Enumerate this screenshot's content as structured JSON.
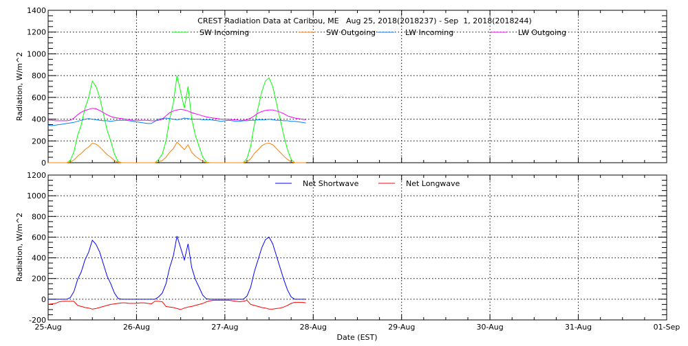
{
  "chart_data": [
    {
      "type": "line",
      "title": "CREST Radiation Data at Caribou, ME   Aug 25, 2018(2018237) - Sep  1, 2018(2018244)",
      "xlabel": "",
      "ylabel": "Radiation, W/m^2",
      "ylim": [
        0,
        1400
      ],
      "yticks": [
        "0",
        "200",
        "400",
        "600",
        "800",
        "1000",
        "1200",
        "1400"
      ],
      "grid": true,
      "legend": "top",
      "x_start_day": 0,
      "x_step_hours": 1,
      "series": [
        {
          "name": "SW Incoming",
          "color": "#00ff00",
          "values": [
            0,
            0,
            0,
            0,
            0,
            0,
            20,
            100,
            250,
            350,
            500,
            600,
            750,
            700,
            600,
            450,
            300,
            200,
            80,
            10,
            0,
            0,
            0,
            0,
            0,
            0,
            0,
            0,
            0,
            0,
            30,
            80,
            200,
            400,
            550,
            800,
            650,
            500,
            700,
            400,
            250,
            150,
            50,
            5,
            0,
            0,
            0,
            0,
            0,
            0,
            0,
            0,
            0,
            0,
            40,
            150,
            350,
            500,
            650,
            750,
            780,
            700,
            550,
            400,
            250,
            120,
            30,
            0,
            0,
            0,
            0
          ]
        },
        {
          "name": "SW Outgoing",
          "color": "#ff7f00",
          "values": [
            0,
            0,
            0,
            0,
            0,
            0,
            5,
            25,
            60,
            85,
            120,
            145,
            180,
            170,
            145,
            110,
            75,
            50,
            20,
            3,
            0,
            0,
            0,
            0,
            0,
            0,
            0,
            0,
            0,
            0,
            8,
            20,
            50,
            95,
            130,
            190,
            155,
            120,
            165,
            95,
            60,
            35,
            12,
            1,
            0,
            0,
            0,
            0,
            0,
            0,
            0,
            0,
            0,
            0,
            10,
            35,
            85,
            120,
            155,
            175,
            180,
            165,
            130,
            95,
            60,
            30,
            8,
            0,
            0,
            0,
            0
          ]
        },
        {
          "name": "LW Incoming",
          "color": "#0080ff",
          "values": [
            345,
            340,
            345,
            350,
            355,
            360,
            365,
            370,
            380,
            390,
            400,
            405,
            400,
            395,
            390,
            385,
            385,
            380,
            385,
            390,
            390,
            390,
            385,
            380,
            375,
            370,
            365,
            360,
            360,
            380,
            400,
            405,
            410,
            405,
            400,
            395,
            400,
            410,
            405,
            400,
            400,
            400,
            395,
            395,
            395,
            390,
            385,
            380,
            385,
            390,
            385,
            380,
            380,
            385,
            385,
            390,
            390,
            395,
            395,
            395,
            400,
            395,
            390,
            390,
            385,
            385,
            380,
            380,
            375,
            370,
            365
          ]
        },
        {
          "name": "LW Outgoing",
          "color": "#ff00ff",
          "values": [
            390,
            390,
            385,
            385,
            385,
            385,
            390,
            410,
            440,
            465,
            480,
            490,
            500,
            495,
            480,
            460,
            440,
            425,
            415,
            410,
            405,
            400,
            395,
            390,
            390,
            390,
            390,
            390,
            385,
            385,
            390,
            400,
            430,
            460,
            475,
            485,
            490,
            485,
            475,
            460,
            450,
            440,
            430,
            420,
            415,
            410,
            405,
            400,
            400,
            400,
            395,
            395,
            390,
            390,
            395,
            410,
            430,
            455,
            470,
            480,
            485,
            485,
            475,
            465,
            450,
            430,
            420,
            410,
            405,
            400,
            395
          ]
        }
      ]
    },
    {
      "type": "line",
      "xlabel": "Date (EST)",
      "ylabel": "Radiation, W/m^2",
      "ylim": [
        -200,
        1200
      ],
      "yticks": [
        "-200",
        "0",
        "200",
        "400",
        "600",
        "800",
        "1000",
        "1200"
      ],
      "xticks": [
        "25-Aug",
        "26-Aug",
        "27-Aug",
        "28-Aug",
        "29-Aug",
        "30-Aug",
        "31-Aug",
        "01-Sep"
      ],
      "grid": true,
      "legend": "top",
      "x_start_day": 0,
      "x_step_hours": 1,
      "series": [
        {
          "name": "Net Shortwave",
          "color": "#0000ff",
          "values": [
            0,
            0,
            0,
            0,
            0,
            0,
            15,
            75,
            190,
            265,
            380,
            455,
            570,
            530,
            455,
            340,
            225,
            150,
            60,
            7,
            0,
            0,
            0,
            0,
            0,
            0,
            0,
            0,
            0,
            0,
            22,
            60,
            150,
            305,
            420,
            610,
            495,
            380,
            535,
            305,
            190,
            115,
            38,
            4,
            0,
            0,
            0,
            0,
            0,
            0,
            0,
            0,
            0,
            0,
            30,
            115,
            265,
            380,
            495,
            575,
            600,
            535,
            420,
            305,
            190,
            90,
            22,
            0,
            0,
            0,
            0
          ]
        },
        {
          "name": "Net Longwave",
          "color": "#ff0000",
          "values": [
            -50,
            -45,
            -40,
            -25,
            -20,
            -20,
            -20,
            -20,
            -60,
            -70,
            -80,
            -85,
            -95,
            -90,
            -80,
            -70,
            -60,
            -50,
            -45,
            -40,
            -35,
            -35,
            -40,
            -40,
            -40,
            -35,
            -35,
            -40,
            -45,
            -20,
            -20,
            -25,
            -70,
            -75,
            -80,
            -90,
            -100,
            -85,
            -75,
            -70,
            -60,
            -50,
            -40,
            -25,
            -15,
            -10,
            -10,
            -10,
            -10,
            -10,
            -15,
            -20,
            -25,
            -20,
            -10,
            -50,
            -60,
            -70,
            -80,
            -85,
            -95,
            -95,
            -90,
            -85,
            -75,
            -60,
            -40,
            -30,
            -30,
            -30,
            -35
          ]
        }
      ]
    }
  ]
}
